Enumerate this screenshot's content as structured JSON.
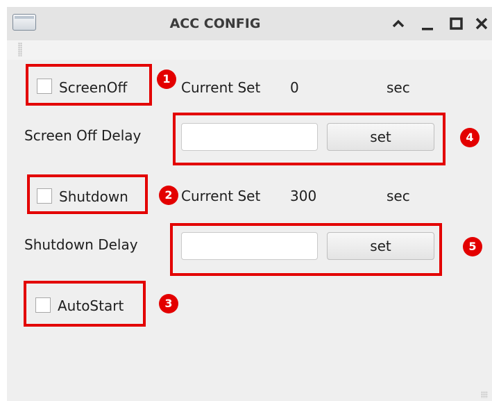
{
  "window": {
    "title": "ACC CONFIG"
  },
  "screen_off": {
    "checkbox_label": "ScreenOff",
    "checked": false,
    "current_set_label": "Current Set",
    "current_value": "0",
    "unit": "sec",
    "delay_label": "Screen Off Delay",
    "delay_input_value": "",
    "set_button_label": "set"
  },
  "shutdown": {
    "checkbox_label": "Shutdown",
    "checked": false,
    "current_set_label": "Current Set",
    "current_value": "300",
    "unit": "sec",
    "delay_label": "Shutdown Delay",
    "delay_input_value": "",
    "set_button_label": "set"
  },
  "autostart": {
    "checkbox_label": "AutoStart",
    "checked": false
  },
  "annotations": {
    "color": "#e30000",
    "badges": [
      "1",
      "2",
      "3",
      "4",
      "5"
    ]
  }
}
